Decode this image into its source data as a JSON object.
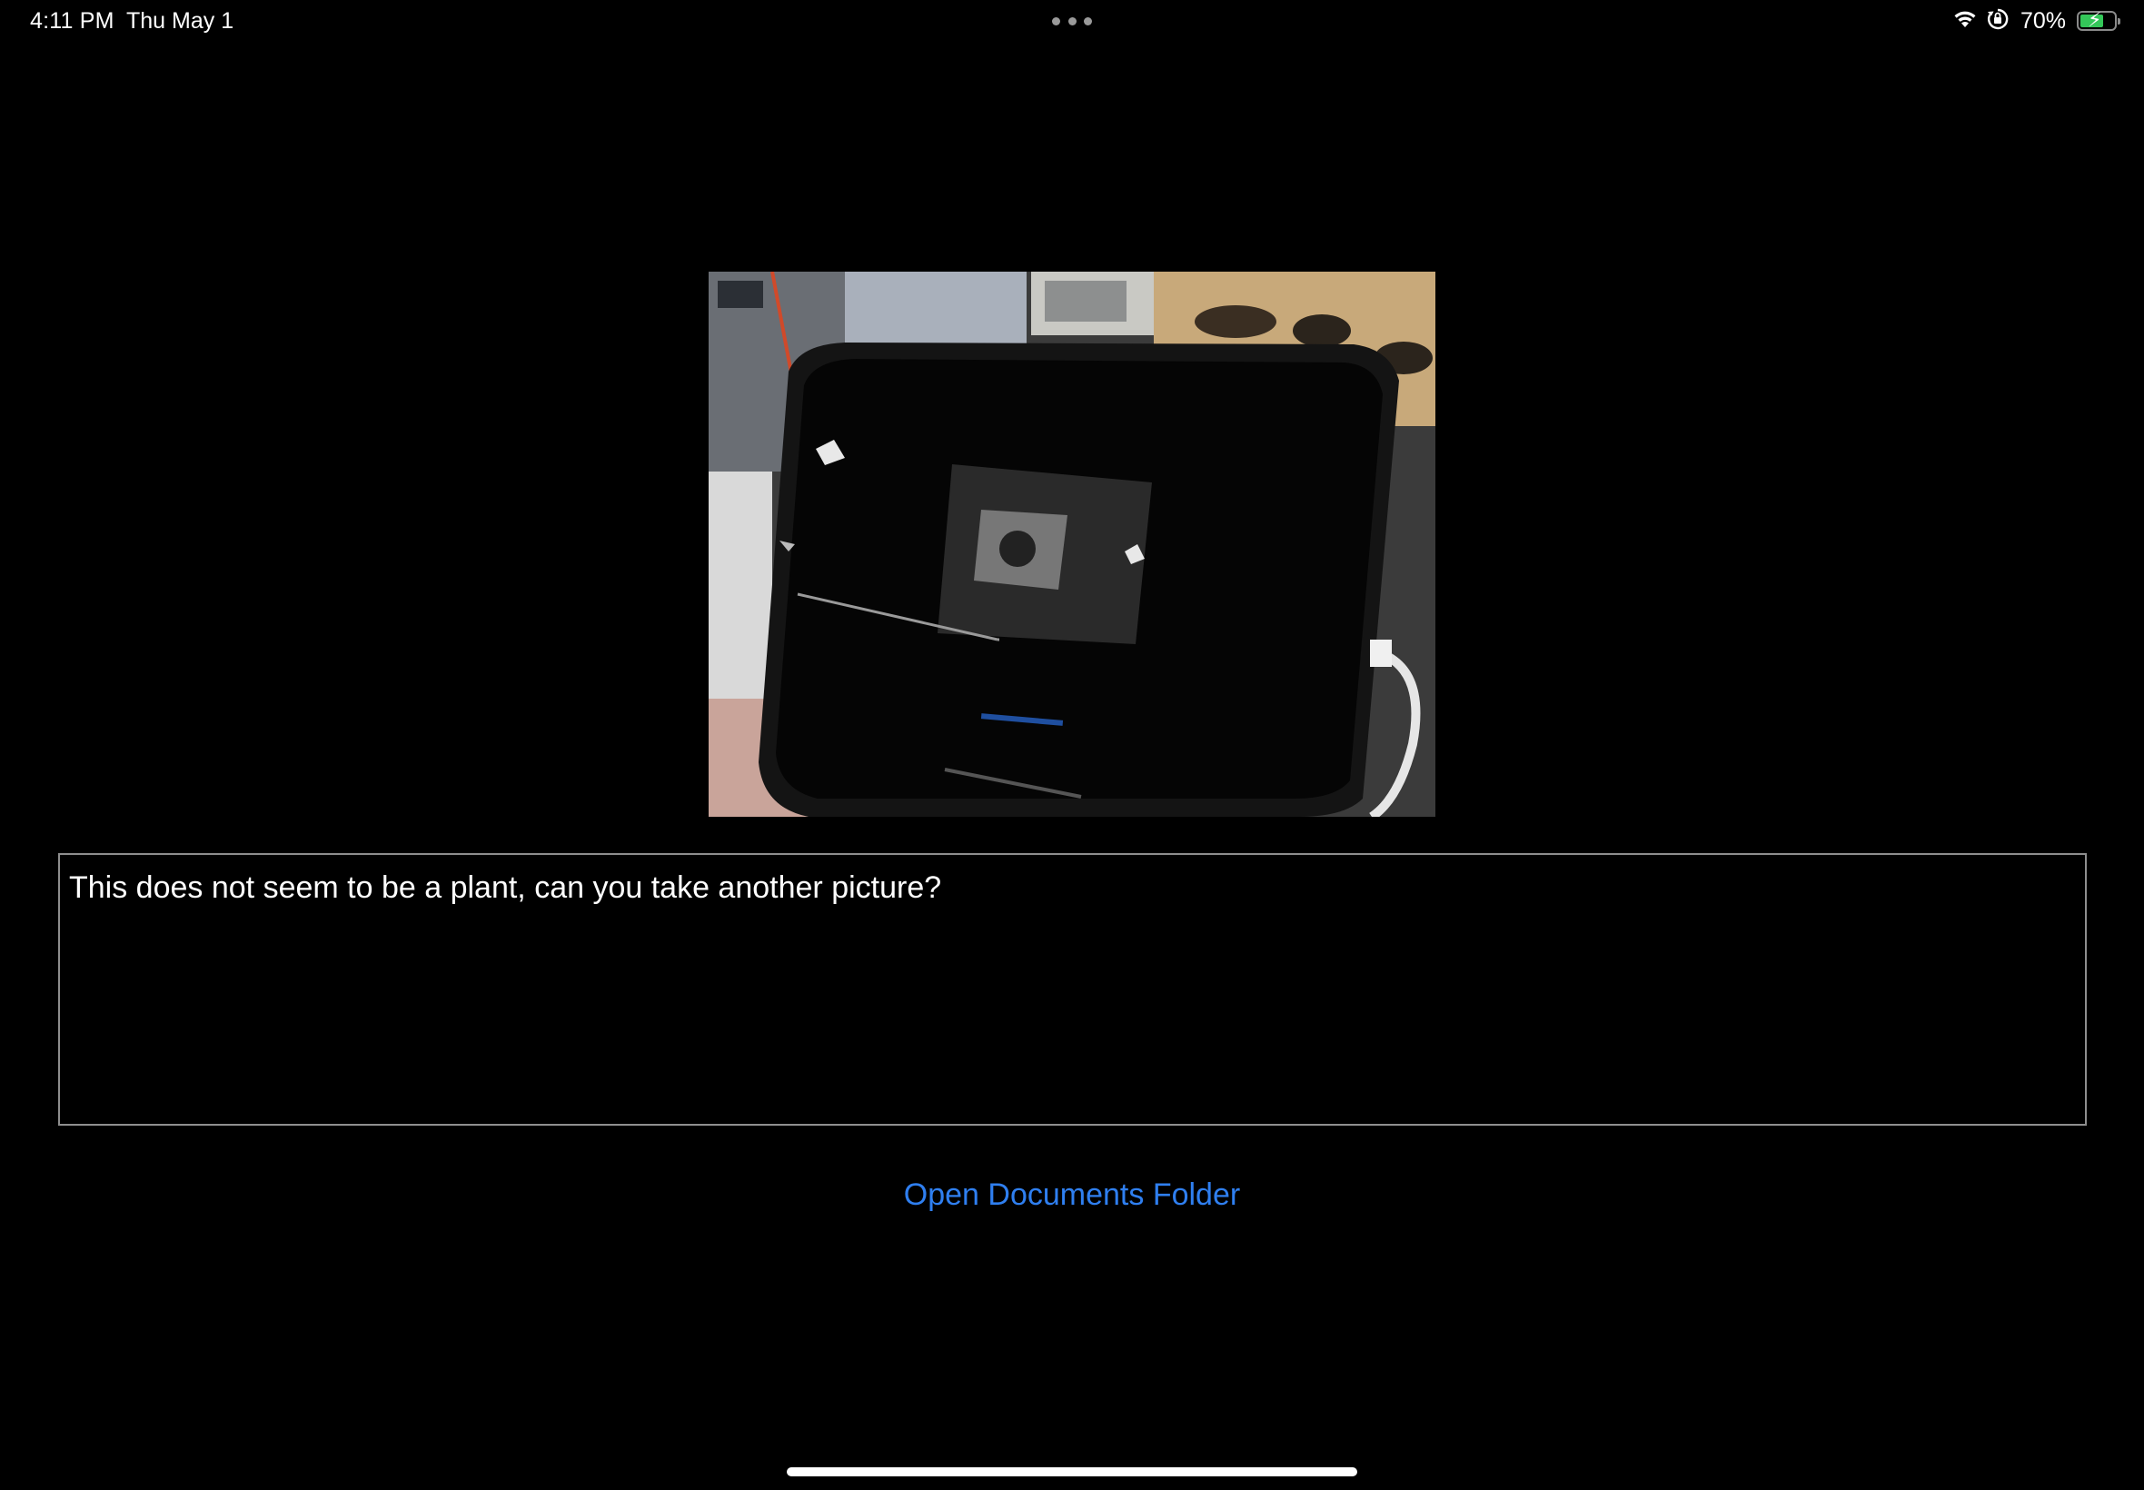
{
  "status_bar": {
    "time": "4:11 PM",
    "date": "Thu May 1",
    "battery_percent": "70%",
    "battery_level": 0.7,
    "icons": [
      "wifi-icon",
      "orientation-lock-icon",
      "battery-charging-icon"
    ]
  },
  "photo": {
    "icon": "captured-photo",
    "embedded_text": "This does not seem to be a plant, can you take another picture?",
    "embedded_button": "Open Documents Folder"
  },
  "result": {
    "text": "This does not seem to be a plant, can you take another picture?"
  },
  "actions": {
    "open_documents_label": "Open Documents Folder"
  },
  "colors": {
    "background": "#000000",
    "accent": "#2f7ff0",
    "battery": "#34c759"
  }
}
